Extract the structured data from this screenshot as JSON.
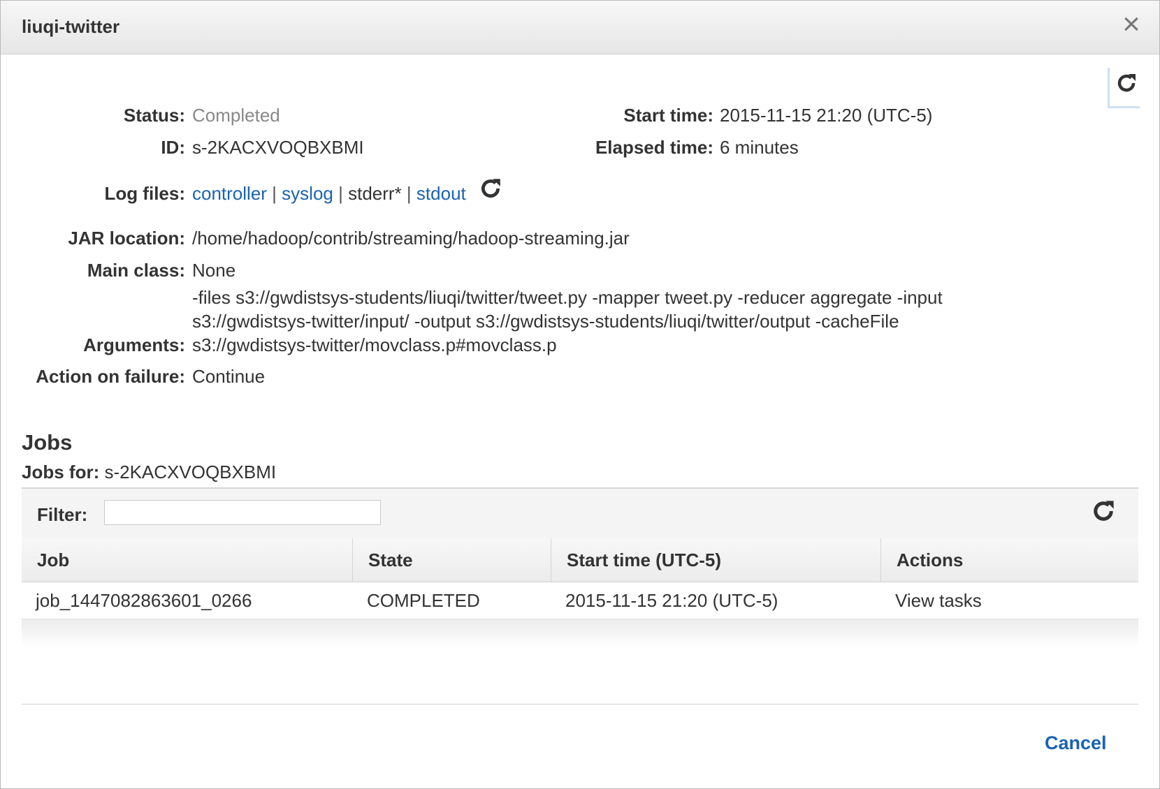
{
  "dialog": {
    "title": "liuqi-twitter",
    "close_icon": "close-icon",
    "refresh_icon": "refresh-icon"
  },
  "details": {
    "status_label": "Status:",
    "status_value": "Completed",
    "id_label": "ID:",
    "id_value": "s-2KACXVOQBXBMI",
    "start_time_label": "Start time:",
    "start_time_value": "2015-11-15 21:20 (UTC-5)",
    "elapsed_label": "Elapsed time:",
    "elapsed_value": "6 minutes",
    "log_files_label": "Log files:",
    "log_files": {
      "controller": "controller",
      "syslog": "syslog",
      "stderr": "stderr*",
      "stdout": "stdout",
      "separator": "|"
    },
    "jar_label": "JAR location:",
    "jar_value": "/home/hadoop/contrib/streaming/hadoop-streaming.jar",
    "main_class_label": "Main class:",
    "main_class_value": "None",
    "arguments_label": "Arguments:",
    "arguments_lines": [
      "-files s3://gwdistsys-students/liuqi/twitter/tweet.py -mapper tweet.py -reducer aggregate -input",
      "s3://gwdistsys-twitter/input/ -output s3://gwdistsys-students/liuqi/twitter/output -cacheFile",
      "s3://gwdistsys-twitter/movclass.p#movclass.p"
    ],
    "action_label": "Action on failure:",
    "action_value": "Continue"
  },
  "jobs": {
    "title": "Jobs",
    "for_label": "Jobs for:",
    "for_value": "s-2KACXVOQBXBMI",
    "filter_label": "Filter:",
    "filter_value": "",
    "columns": [
      "Job",
      "State",
      "Start time (UTC-5)",
      "Actions"
    ],
    "rows": [
      {
        "job": "job_1447082863601_0266",
        "state": "COMPLETED",
        "start": "2015-11-15 21:20 (UTC-5)",
        "action": "View tasks"
      }
    ]
  },
  "footer": {
    "cancel_label": "Cancel"
  },
  "colors": {
    "link": "#1a63b0",
    "muted": "#888888",
    "accent_border": "#cfe0f2"
  }
}
